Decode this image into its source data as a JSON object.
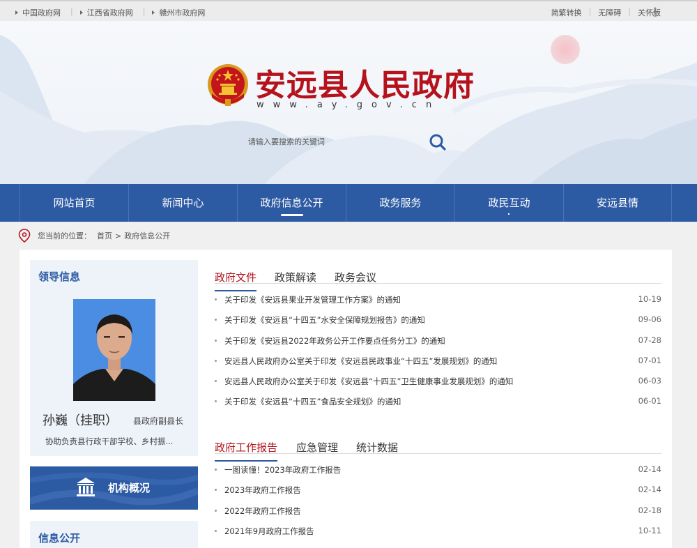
{
  "topbar": {
    "links": [
      "中国政府网",
      "江西省政府网",
      "赣州市政府网"
    ],
    "tools": [
      "简繁转换",
      "无障碍",
      "关怀版"
    ]
  },
  "header": {
    "title": "安远县人民政府",
    "domain": "www.ay.gov.cn",
    "search_placeholder": "请输入要搜索的关键词"
  },
  "nav": {
    "items": [
      "网站首页",
      "新闻中心",
      "政府信息公开",
      "政务服务",
      "政民互动",
      "安远县情"
    ],
    "active": "政府信息公开"
  },
  "breadcrumb": {
    "label": "您当前的位置：",
    "home": "首页",
    "sep": ">",
    "current": "政府信息公开"
  },
  "leader": {
    "section_title": "领导信息",
    "name": "孙巍（挂职）",
    "role": "县政府副县长",
    "desc": "协助负责县行政干部学校、乡村振..."
  },
  "org_button": {
    "label": "机构概况"
  },
  "info_section": {
    "title": "信息公开"
  },
  "docs": {
    "tabs": [
      "政府文件",
      "政策解读",
      "政务会议"
    ],
    "items": [
      {
        "title": "关于印发《安远县果业开发管理工作方案》的通知",
        "date": "10-19"
      },
      {
        "title": "关于印发《安远县“十四五”水安全保障规划报告》的通知",
        "date": "09-06"
      },
      {
        "title": "关于印发《安远县2022年政务公开工作要点任务分工》的通知",
        "date": "07-28"
      },
      {
        "title": "安远县人民政府办公室关于印发《安远县民政事业“十四五”发展规划》的通知",
        "date": "07-01"
      },
      {
        "title": "安远县人民政府办公室关于印发《安远县“十四五”卫生健康事业发展规划》的通知",
        "date": "06-03"
      },
      {
        "title": "关于印发《安远县“十四五”食品安全规划》的通知",
        "date": "06-01"
      }
    ]
  },
  "reports": {
    "tabs": [
      "政府工作报告",
      "应急管理",
      "统计数据"
    ],
    "items": [
      {
        "title": "一图读懂！2023年政府工作报告",
        "date": "02-14"
      },
      {
        "title": "2023年政府工作报告",
        "date": "02-14"
      },
      {
        "title": "2022年政府工作报告",
        "date": "02-18"
      },
      {
        "title": "2021年9月政府工作报告",
        "date": "10-11"
      }
    ]
  },
  "colors": {
    "brand_red": "#b5121b",
    "nav_blue": "#2c5aa3"
  }
}
